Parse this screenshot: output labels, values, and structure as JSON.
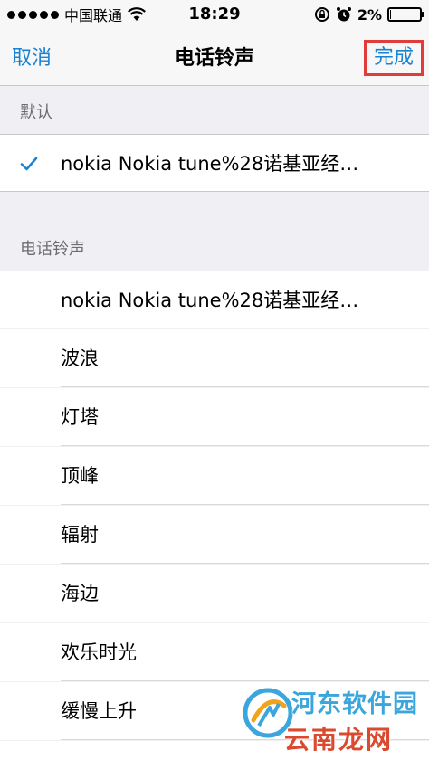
{
  "status_bar": {
    "carrier": "中国联通",
    "time": "18:29",
    "battery": "2%",
    "battery_level": 0.02,
    "icons": [
      "signal-dots-icon",
      "wifi-icon",
      "rotation-lock-icon",
      "alarm-icon",
      "battery-icon"
    ]
  },
  "nav": {
    "cancel_label": "取消",
    "title": "电话铃声",
    "done_label": "完成"
  },
  "sections": {
    "default_header": "默认",
    "ringtone_header": "电话铃声"
  },
  "default_row": {
    "label": "nokia Nokia tune%28诺基亚经…",
    "checked": true
  },
  "ringtones": [
    "nokia Nokia tune%28诺基亚经…",
    "波浪",
    "灯塔",
    "顶峰",
    "辐射",
    "海边",
    "欢乐时光",
    "缓慢上升"
  ],
  "watermark": {
    "line1": "河东软件园",
    "line2": "云南龙网"
  },
  "colors": {
    "accent": "#1a82d2",
    "highlight_border": "#e03c3c",
    "background": "#efeff4"
  }
}
